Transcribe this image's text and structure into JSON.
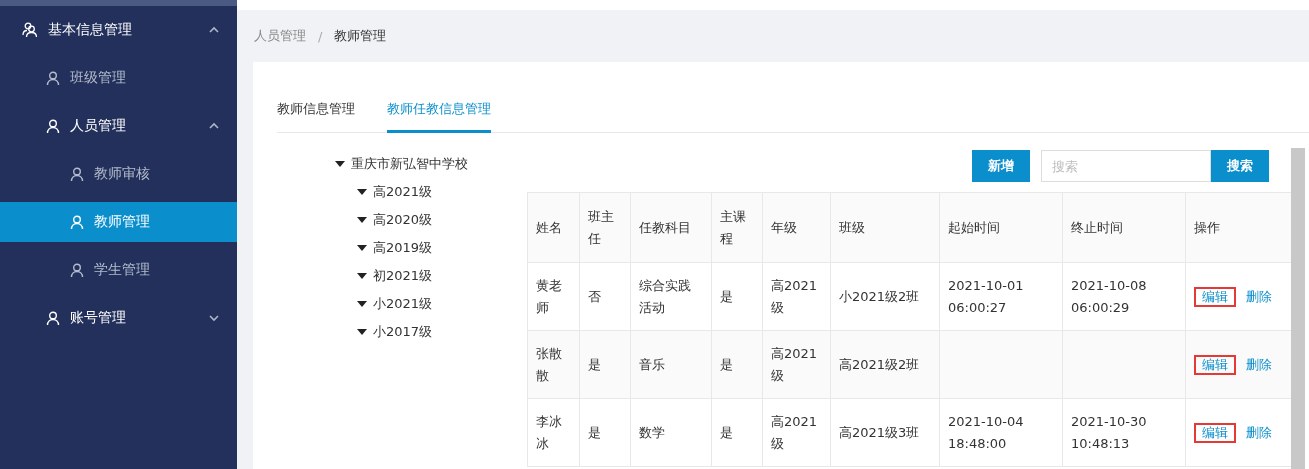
{
  "sidebar": {
    "items": [
      {
        "label": "基本信息管理",
        "expanded": true,
        "selected": false,
        "children": [
          {
            "label": "班级管理",
            "selected": false
          },
          {
            "label": "人员管理",
            "expanded": true,
            "selected": false,
            "children": [
              {
                "label": "教师审核",
                "selected": false
              },
              {
                "label": "教师管理",
                "selected": true
              },
              {
                "label": "学生管理",
                "selected": false
              }
            ]
          },
          {
            "label": "账号管理",
            "expanded": false,
            "selected": false
          }
        ]
      }
    ]
  },
  "breadcrumb": [
    {
      "label": "人员管理",
      "current": false
    },
    {
      "label": "教师管理",
      "current": true
    }
  ],
  "breadcrumb_separator": "/",
  "tabs": [
    {
      "label": "教师信息管理",
      "selected": false
    },
    {
      "label": "教师任教信息管理",
      "selected": true
    }
  ],
  "tree": [
    {
      "label": "重庆市新弘智中学校",
      "expanded": true,
      "children": [
        {
          "label": "高2021级",
          "expanded": true
        },
        {
          "label": "高2020级",
          "expanded": true
        },
        {
          "label": "高2019级",
          "expanded": true
        },
        {
          "label": "初2021级",
          "expanded": true
        },
        {
          "label": "小2021级",
          "expanded": true
        },
        {
          "label": "小2017级",
          "expanded": true
        }
      ]
    }
  ],
  "toolbar": {
    "add_button": "新增",
    "search": {
      "placeholder": "搜索"
    },
    "search_button": "搜索"
  },
  "table": {
    "columns": [
      "姓名",
      "班主任",
      "任教科目",
      "主课程",
      "年级",
      "班级",
      "起始时间",
      "终止时间",
      "操作"
    ],
    "rows": [
      {
        "cells": [
          "黄老师",
          "否",
          "综合实践活动",
          "是",
          "高2021级",
          "小2021级2班",
          "2021-10-01 06:00:27",
          "2021-10-08 06:00:29"
        ],
        "actions": [
          {
            "label": "编辑",
            "highlighted": true
          },
          {
            "label": "删除",
            "highlighted": false
          }
        ]
      },
      {
        "cells": [
          "张散散",
          "是",
          "音乐",
          "是",
          "高2021级",
          "高2021级2班",
          "",
          ""
        ],
        "actions": [
          {
            "label": "编辑",
            "highlighted": true
          },
          {
            "label": "删除",
            "highlighted": false
          }
        ]
      },
      {
        "cells": [
          "李冰冰",
          "是",
          "数学",
          "是",
          "高2021级",
          "高2021级3班",
          "2021-10-04 18:48:00",
          "2021-10-30 10:48:13"
        ],
        "actions": [
          {
            "label": "编辑",
            "highlighted": true
          },
          {
            "label": "删除",
            "highlighted": false
          }
        ]
      }
    ]
  }
}
